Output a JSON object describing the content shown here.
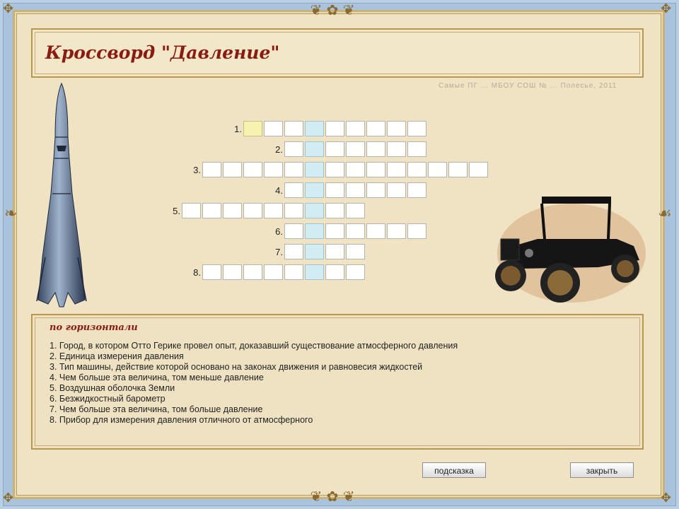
{
  "title": "Кроссворд \"Давление\"",
  "subtitle": "Самые ПГ ... МБОУ СОШ № ... Полесье, 2011",
  "crossword": {
    "rows": [
      {
        "label": "1.",
        "start": 0,
        "length": 9
      },
      {
        "label": "2.",
        "start": 2,
        "length": 7
      },
      {
        "label": "3.",
        "start": -2,
        "length": 14
      },
      {
        "label": "4.",
        "start": 2,
        "length": 7
      },
      {
        "label": "5.",
        "start": -3,
        "length": 9
      },
      {
        "label": "6.",
        "start": 2,
        "length": 7
      },
      {
        "label": "7.",
        "start": 2,
        "length": 4
      },
      {
        "label": "8.",
        "start": -2,
        "length": 8
      }
    ],
    "key_column": 3,
    "active_cell": {
      "row": 0,
      "col": 0
    }
  },
  "clues": {
    "heading": "по горизонтали",
    "items": [
      "1. Город, в котором Отто Герике провел опыт, доказавший существование атмосферного давления",
      "2. Единица измерения давления",
      "3. Тип машины, действие которой основано на законах движения и равновесия жидкостей",
      "4. Чем больше эта величина, том меньше давление",
      "5. Воздушная оболочка Земли",
      "6. Безжидкостный барометр",
      "7. Чем больше эта величина, том больше давление",
      "8. Прибор для измерения давления отличного от атмосферного"
    ]
  },
  "buttons": {
    "hint": "подсказка",
    "close": "закрыть"
  }
}
